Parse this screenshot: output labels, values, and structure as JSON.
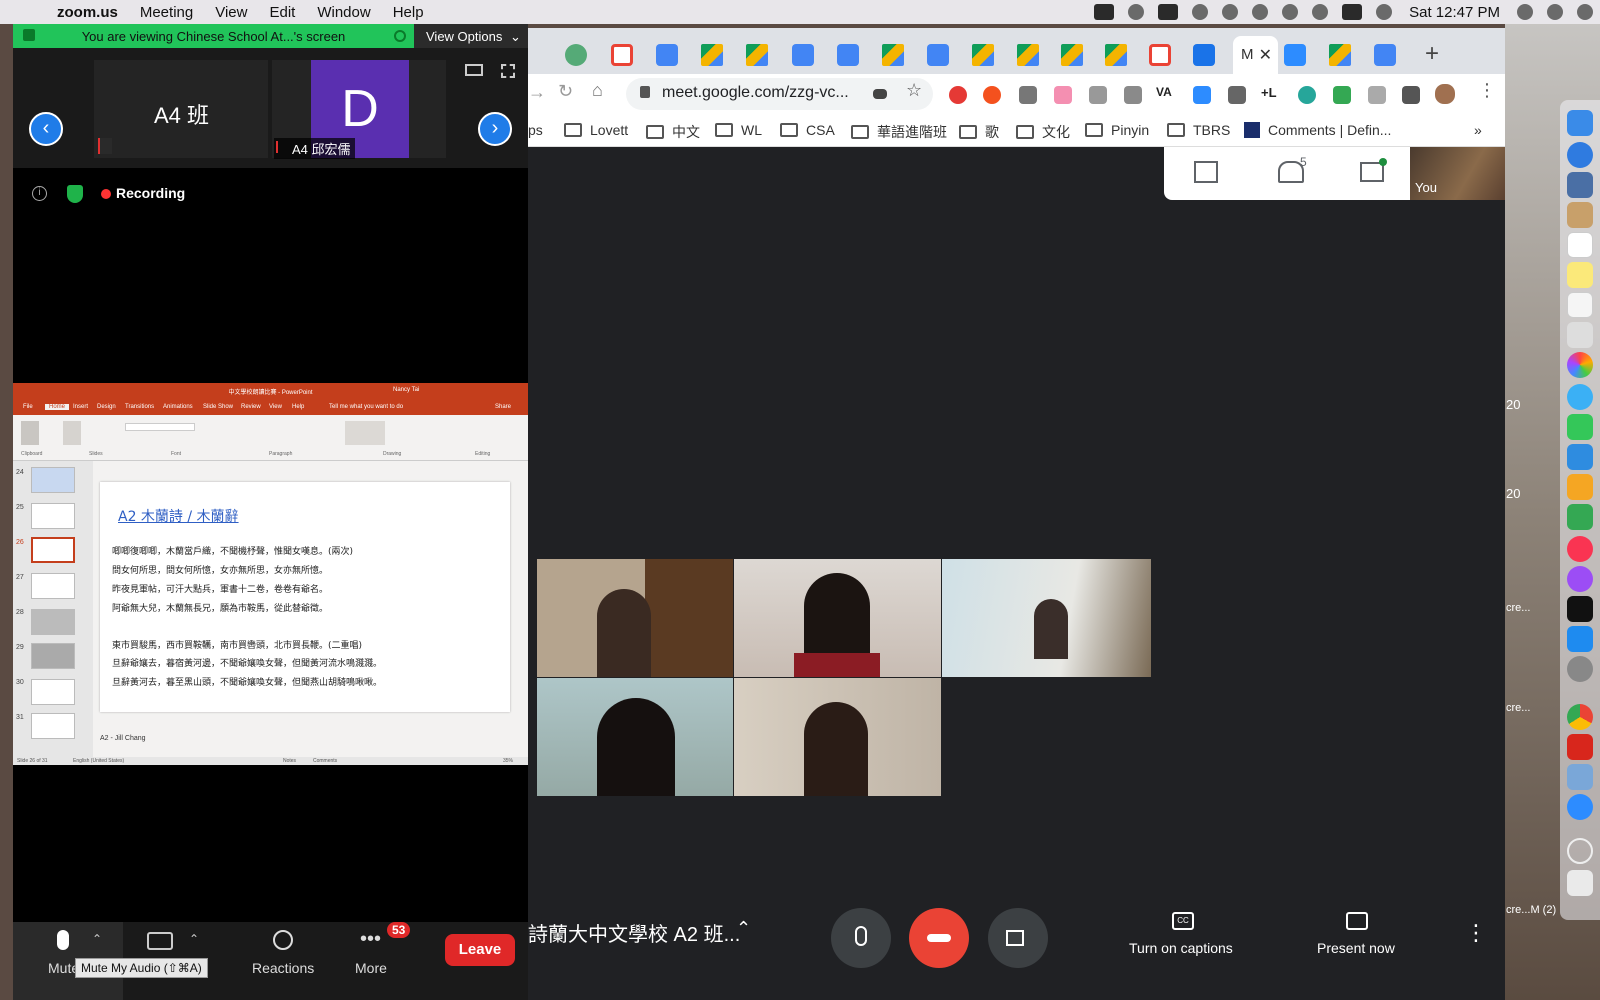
{
  "menubar": {
    "app_name": "zoom.us",
    "items": [
      "Meeting",
      "View",
      "Edit",
      "Window",
      "Help"
    ],
    "clock": "Sat 12:47 PM"
  },
  "zoom": {
    "banner": "You are viewing Chinese School At...'s screen",
    "view_options": "View Options",
    "participants": [
      {
        "tile_name": "A4 班",
        "label": ""
      },
      {
        "initial": "D",
        "label": "A4 邱宏儒"
      }
    ],
    "recording": "Recording",
    "controls": {
      "mute": "Mute",
      "mute_tooltip": "Mute My Audio (⇧⌘A)",
      "reactions": "Reactions",
      "more": "More",
      "more_badge": "53",
      "leave": "Leave"
    }
  },
  "ppt": {
    "titlebar": "中文學校朗讀比賽 - PowerPoint",
    "user": "Nancy Tai",
    "tabs": [
      "File",
      "Home",
      "Insert",
      "Design",
      "Transitions",
      "Animations",
      "Slide Show",
      "Review",
      "View",
      "Help",
      "Tell me what you want to do",
      "Share"
    ],
    "ribbon_groups": [
      "Clipboard",
      "Slides",
      "Font",
      "Paragraph",
      "Drawing",
      "Editing"
    ],
    "thumb_numbers": [
      "24",
      "25",
      "26",
      "27",
      "28",
      "29",
      "30",
      "31"
    ],
    "slide_title": "A2  木蘭詩 / 木蘭辭",
    "poem_lines": [
      "唧唧復唧唧，木蘭當戶織，不聞機杼聲，惟聞女嘆息。(兩次)",
      "問女何所思，問女何所憶，女亦無所思，女亦無所憶。",
      "昨夜見軍帖，可汗大點兵，軍書十二卷，卷卷有爺名。",
      "阿爺無大兒，木蘭無長兄，願為市鞍馬，從此替爺徵。",
      "",
      "東市買駿馬，西市買鞍韉，南市買轡頭，北市買長鞭。(二重唱)",
      "旦辭爺孃去，暮宿黃河邊，不聞爺孃喚女聲，但聞黃河流水鳴濺濺。",
      "旦辭黃河去，暮至黑山頭，不聞爺孃喚女聲，但聞燕山胡騎鳴啾啾。"
    ],
    "notes": "A2 - Jill Chang",
    "status_left": "Slide 26 of 31",
    "status_lang": "English (United States)",
    "status_notes": "Notes",
    "status_comments": "Comments",
    "zoom_pct": "35%"
  },
  "chrome": {
    "active_tab_label": "M",
    "url": "meet.google.com/zzg-vc...",
    "bookmarks": [
      "ps",
      "Lovett",
      "中文",
      "WL",
      "CSA",
      "華語進階班",
      "歌",
      "文化",
      "Pinyin",
      "TBRS",
      "Comments | Defin..."
    ],
    "ext_labels": [
      "VA",
      "+L"
    ]
  },
  "meet": {
    "people_count": "5",
    "self_label": "You",
    "meeting_name": "詩蘭大中文學校 A2 班...",
    "captions": "Turn on captions",
    "present": "Present now"
  },
  "desktop": {
    "labels": [
      "20",
      "20",
      "cre...",
      "cre...",
      "cre...M (2)"
    ]
  },
  "colors": {
    "zoom_banner": "#21c45a",
    "zoom_blue": "#1f7ce8",
    "leave_red": "#e02828",
    "ppt_orange": "#c43e1c",
    "meet_bg": "#202124",
    "meet_red": "#ea4335"
  }
}
